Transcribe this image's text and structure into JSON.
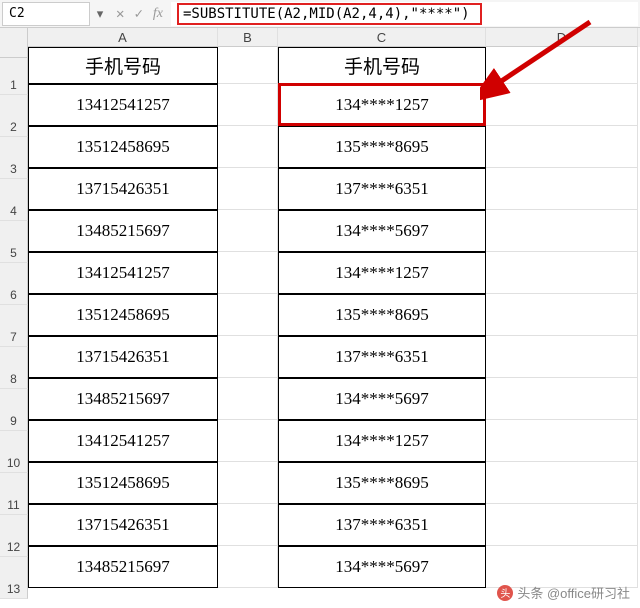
{
  "formulaBar": {
    "nameBox": "C2",
    "formula": "=SUBSTITUTE(A2,MID(A2,4,4),\"****\")"
  },
  "columns": [
    "A",
    "B",
    "C",
    "D"
  ],
  "headerRow": {
    "A": "手机号码",
    "C": "手机号码"
  },
  "rows": [
    {
      "A": "13412541257",
      "C": "134****1257"
    },
    {
      "A": "13512458695",
      "C": "135****8695"
    },
    {
      "A": "13715426351",
      "C": "137****6351"
    },
    {
      "A": "13485215697",
      "C": "134****5697"
    },
    {
      "A": "13412541257",
      "C": "134****1257"
    },
    {
      "A": "13512458695",
      "C": "135****8695"
    },
    {
      "A": "13715426351",
      "C": "137****6351"
    },
    {
      "A": "13485215697",
      "C": "134****5697"
    },
    {
      "A": "13412541257",
      "C": "134****1257"
    },
    {
      "A": "13512458695",
      "C": "135****8695"
    },
    {
      "A": "13715426351",
      "C": "137****6351"
    },
    {
      "A": "13485215697",
      "C": "134****5697"
    }
  ],
  "selectedCell": "C2",
  "watermark": "头条 @office研习社"
}
